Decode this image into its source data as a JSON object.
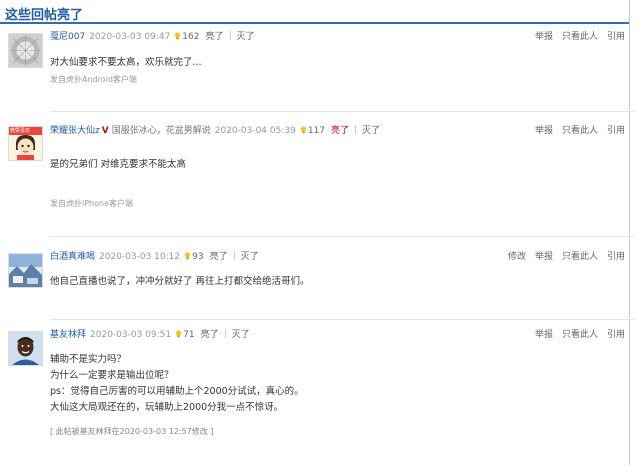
{
  "section": {
    "title": "这些回帖亮了"
  },
  "posts": [
    {
      "username": "戛尼007",
      "time": "2020-03-03 09:47",
      "light_count": "162",
      "light_label": "亮了",
      "dark_label": "灭了",
      "ops": [
        "举报",
        "只看此人",
        "引用"
      ],
      "content": [
        "对大仙要求不要太高，欢乐就完了..."
      ],
      "source": "发自虎扑Android客户端"
    },
    {
      "username": "荣耀张大仙z",
      "vip": "V",
      "honor": "国服张冰心，花盆男解说",
      "time": "2020-03-04 05:39",
      "light_count": "117",
      "light_label": "亮了",
      "dark_label": "灭了",
      "ops": [
        "举报",
        "只看此人",
        "引用"
      ],
      "avatar_text": "微赞喜欢",
      "content": [
        "是的兄弟们 对维克要求不能太高"
      ],
      "source": "发自虎扑iPhone客户端"
    },
    {
      "username": "白酒真难喝",
      "time": "2020-03-03 10:12",
      "light_count": "93",
      "light_label": "亮了",
      "dark_label": "灭了",
      "ops": [
        "修改",
        "举报",
        "只看此人",
        "引用"
      ],
      "content": [
        "他自己直播也说了，冲冲分就好了 再往上打都交给绝活哥们。"
      ]
    },
    {
      "username": "基友林拜",
      "time": "2020-03-03 09:51",
      "light_count": "71",
      "light_label": "亮了",
      "dark_label": "灭了",
      "ops": [
        "举报",
        "只看此人",
        "引用"
      ],
      "content": [
        "辅助不是实力吗？",
        "为什么一定要求是输出位呢？",
        "ps：觉得自己厉害的可以用辅助上个2000分试试，真心的。",
        "大仙这大局观还在的，玩辅助上2000分我一点不惊讶。"
      ],
      "edit_note": "[ 此帖被基友林拜在2020-03-03 12:57修改 ]"
    }
  ]
}
